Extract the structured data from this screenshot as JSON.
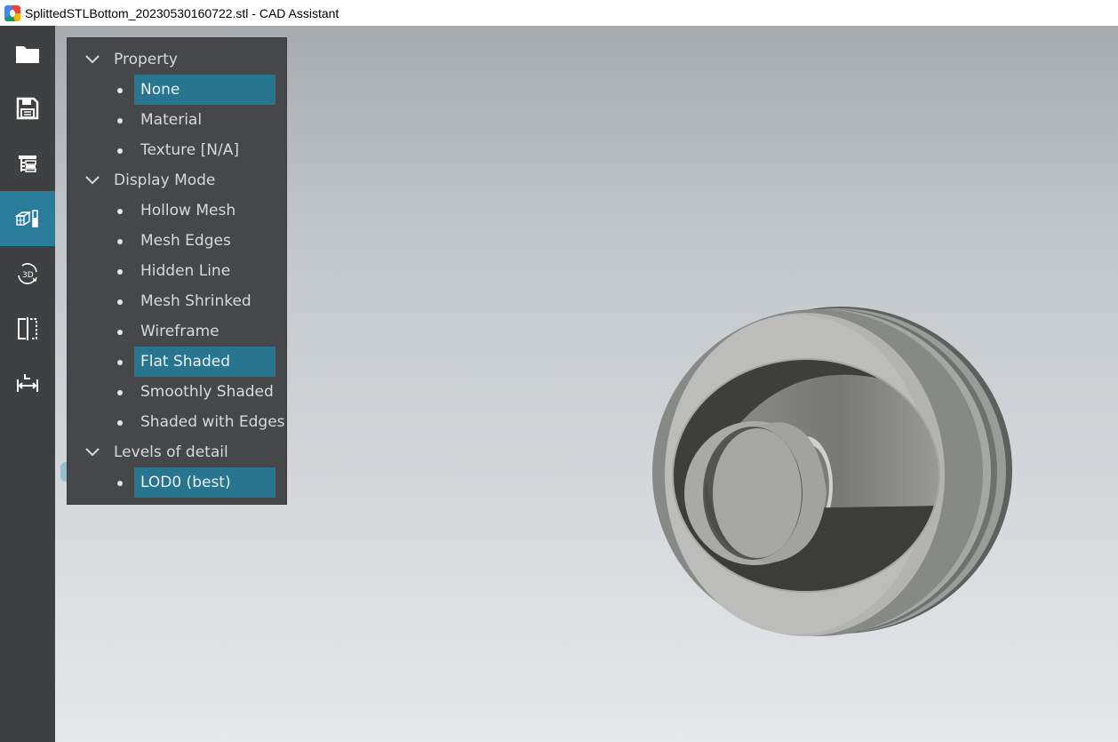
{
  "window": {
    "title": "SplittedSTLBottom_20230530160722.stl - CAD Assistant"
  },
  "toolbar": {
    "tools": [
      {
        "icon": "folder-icon",
        "active": false
      },
      {
        "icon": "save-icon",
        "active": false
      },
      {
        "icon": "model-tree-icon",
        "active": false
      },
      {
        "icon": "display-settings-icon",
        "active": true
      },
      {
        "icon": "3d-rotate-icon",
        "active": false
      },
      {
        "icon": "section-plane-icon",
        "active": false
      },
      {
        "icon": "measure-icon",
        "active": false
      }
    ]
  },
  "panel": {
    "groups": [
      {
        "header": "Property",
        "items": [
          {
            "label": "None",
            "selected": true
          },
          {
            "label": "Material",
            "selected": false
          },
          {
            "label": "Texture [N/A]",
            "selected": false
          }
        ]
      },
      {
        "header": "Display Mode",
        "items": [
          {
            "label": "Hollow Mesh",
            "selected": false
          },
          {
            "label": "Mesh Edges",
            "selected": false
          },
          {
            "label": "Hidden Line",
            "selected": false
          },
          {
            "label": "Mesh Shrinked",
            "selected": false
          },
          {
            "label": "Wireframe",
            "selected": false
          },
          {
            "label": "Flat Shaded",
            "selected": true
          },
          {
            "label": "Smoothly Shaded",
            "selected": false
          },
          {
            "label": "Shaded with Edges",
            "selected": false
          }
        ]
      },
      {
        "header": "Levels of detail",
        "items": [
          {
            "label": "LOD0 (best)",
            "selected": true
          }
        ]
      }
    ]
  },
  "colors": {
    "accent": "#28758f",
    "toolbar_bg": "#3f4041",
    "panel_bg": "#454748"
  }
}
